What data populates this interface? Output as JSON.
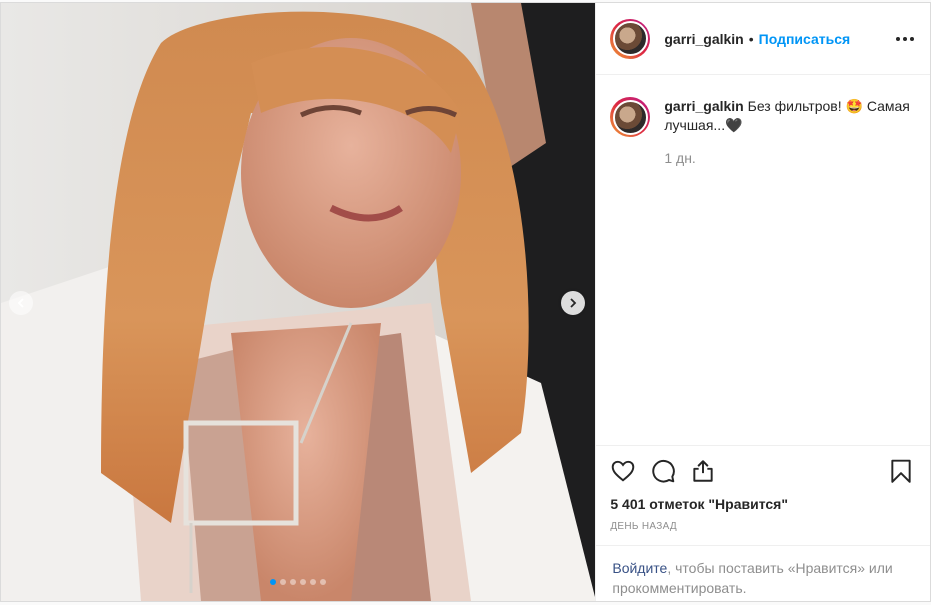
{
  "post": {
    "author": "garri_galkin",
    "separator": "•",
    "follow_label": "Подписаться",
    "more_icon": "more-horizontal-icon"
  },
  "media": {
    "prev_icon": "chevron-left-icon",
    "next_icon": "chevron-right-icon",
    "carousel": {
      "count": 6,
      "active": 0
    }
  },
  "caption": {
    "username": "garri_galkin",
    "text": "Без фильтров! 🤩 Самая лучшая...🖤",
    "time": "1 дн."
  },
  "actions": {
    "like_icon": "heart-icon",
    "comment_icon": "comment-icon",
    "share_icon": "share-icon",
    "save_icon": "bookmark-icon",
    "likes": "5 401 отметок \"Нравится\"",
    "date": "день назад"
  },
  "login_prompt": {
    "link": "Войдите",
    "text": ", чтобы поставить «Нравится» или прокомментировать."
  },
  "colors": {
    "accent": "#0095f6",
    "link": "#385185",
    "muted": "#8e8e8e"
  }
}
